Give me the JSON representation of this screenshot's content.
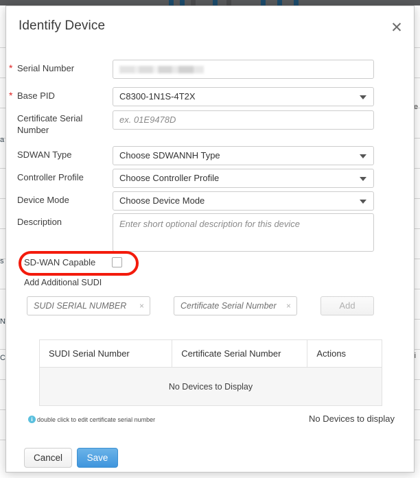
{
  "backdrop": {
    "left_fragments": [
      "a",
      "s",
      "N",
      "C"
    ],
    "right_fragments": [
      "te",
      "ri"
    ]
  },
  "modal": {
    "title": "Identify Device",
    "close_label": "✕",
    "fields": [
      {
        "label": "Serial Number",
        "required": true,
        "control": "text",
        "value": "",
        "redacted": true,
        "placeholder": ""
      },
      {
        "label": "Base PID",
        "required": true,
        "control": "select",
        "value": "C8300-1N1S-4T2X",
        "placeholder": ""
      },
      {
        "label": "Certificate Serial Number",
        "required": false,
        "control": "text",
        "value": "",
        "placeholder": "ex. 01E9478D"
      },
      {
        "label": "SDWAN Type",
        "required": false,
        "control": "select",
        "value": "Choose SDWANNH Type",
        "placeholder": ""
      },
      {
        "label": "Controller Profile",
        "required": false,
        "control": "select",
        "value": "Choose Controller Profile",
        "placeholder": ""
      },
      {
        "label": "Device Mode",
        "required": false,
        "control": "select",
        "value": "Choose Device Mode",
        "placeholder": ""
      },
      {
        "label": "Description",
        "required": false,
        "control": "textarea",
        "value": "",
        "placeholder": "Enter short optional description for this device"
      }
    ],
    "sdwan_capable": {
      "label": "SD-WAN Capable",
      "checked": false,
      "highlight_color": "#f31b0c"
    },
    "additional_sudi": {
      "heading": "Add Additional SUDI",
      "serial_placeholder": "SUDI SERIAL NUMBER",
      "cert_placeholder": "Certificate Serial Number",
      "clear_label": "×",
      "add_button": "Add"
    },
    "sudi_table": {
      "columns": [
        "SUDI Serial Number",
        "Certificate Serial Number",
        "Actions"
      ],
      "rows": [],
      "empty_message": "No Devices to Display"
    },
    "footer": {
      "info_icon_label": "i",
      "info_text": "double click to edit certificate serial number",
      "no_devices_text": "No Devices to display",
      "cancel_label": "Cancel",
      "save_label": "Save",
      "save_color": "#3f95dd"
    }
  }
}
